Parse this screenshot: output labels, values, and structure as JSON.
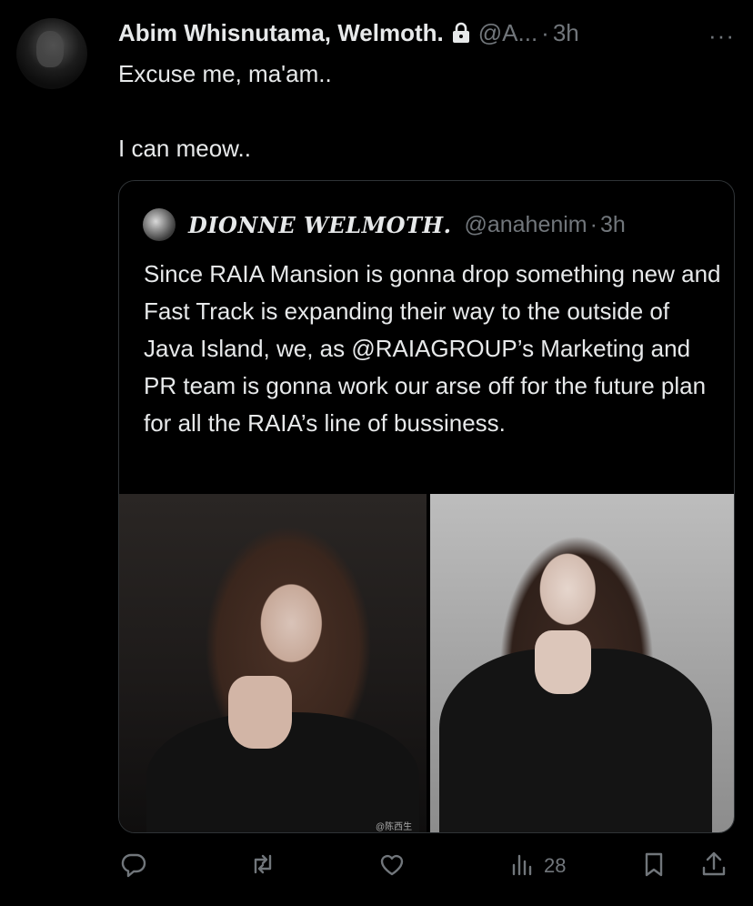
{
  "tweet": {
    "author_name": "Abim Whisnutama, Welmoth.",
    "author_handle": "@A...",
    "separator": "·",
    "time": "3h",
    "more": "···",
    "lines": [
      "Excuse me, ma'am..",
      "I can meow.."
    ]
  },
  "quoted": {
    "author_name": "DIONNE WELMOTH.",
    "author_handle": "@anahenim",
    "separator": "·",
    "time": "3h",
    "text": "Since RAIA Mansion is gonna drop something new and Fast Track is expanding their way to the outside of Java Island, we, as @RAIAGROUP’s Marketing and PR team is gonna work our arse off for the future plan for all the RAIA’s line of bussiness.",
    "watermark": "@陈西生"
  },
  "actions": {
    "views_count": "28"
  },
  "icons": {
    "lock": "lock-icon",
    "reply": "reply-icon",
    "retweet": "retweet-icon",
    "like": "heart-icon",
    "views": "views-chart-icon",
    "bookmark": "bookmark-icon",
    "share": "share-icon"
  },
  "colors": {
    "background": "#000000",
    "text": "#e7e9ea",
    "muted": "#71767b",
    "border": "#2f3336"
  }
}
